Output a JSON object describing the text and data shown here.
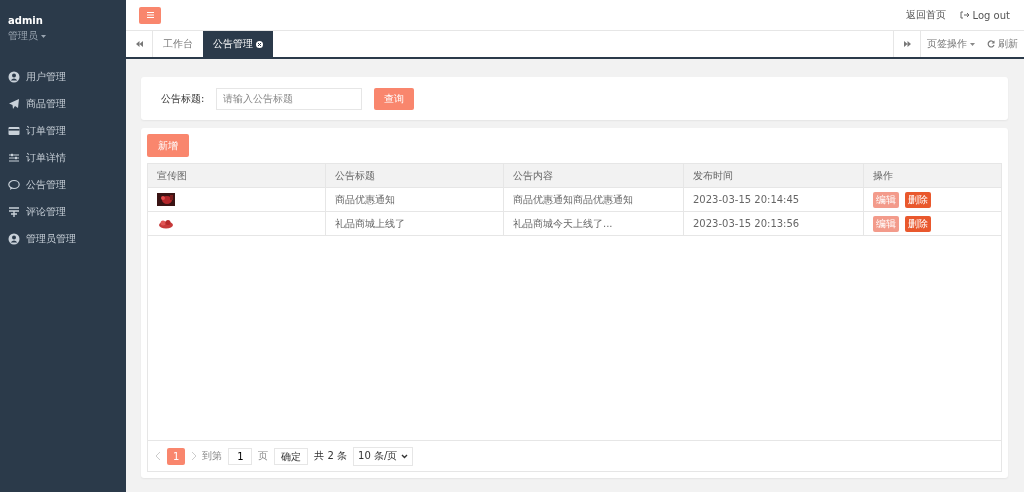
{
  "sidebar": {
    "user": "admin",
    "role": "管理员",
    "items": [
      {
        "label": "用户管理"
      },
      {
        "label": "商品管理"
      },
      {
        "label": "订单管理"
      },
      {
        "label": "订单详情"
      },
      {
        "label": "公告管理"
      },
      {
        "label": "评论管理"
      },
      {
        "label": "管理员管理"
      }
    ]
  },
  "header": {
    "links": [
      "返回首页",
      "Log out"
    ]
  },
  "tabs": [
    {
      "label": "工作台",
      "selected": false,
      "closable": false
    },
    {
      "label": "公告管理",
      "selected": true,
      "closable": true
    }
  ],
  "tab_tools": {
    "page_ops": "页签操作",
    "refresh": "刷新"
  },
  "search": {
    "label": "公告标题:",
    "placeholder": "请输入公告标题",
    "button": "查询"
  },
  "add_button": "新增",
  "table": {
    "columns": [
      "宣传图",
      "公告标题",
      "公告内容",
      "发布时间",
      "操作"
    ],
    "rows": [
      {
        "title": "商品优惠通知",
        "content": "商品优惠通知商品优惠通知",
        "time": "2023-03-15 20:14:45",
        "actions": [
          "编辑",
          "删除"
        ]
      },
      {
        "title": "礼品商城上线了",
        "content": "礼品商城今天上线了...",
        "time": "2023-03-15 20:13:56",
        "actions": [
          "编辑",
          "删除"
        ]
      }
    ]
  },
  "pager": {
    "pages": [
      {
        "label": "1",
        "selected": true
      }
    ],
    "goto": "到第",
    "page_value": "1",
    "page_unit": "页",
    "confirm": "确定",
    "total": "共 2 条",
    "page_size": "10 条/页"
  }
}
